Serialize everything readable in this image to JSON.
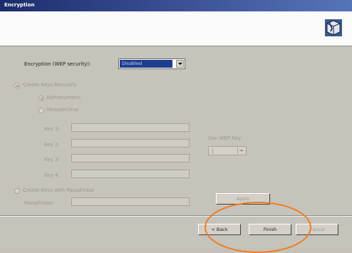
{
  "window": {
    "title": "Encryption"
  },
  "encryption": {
    "label": "Encryption (WEP security):",
    "selected": "Disabled"
  },
  "manual": {
    "radio_label": "Create Keys Manually",
    "alphanumeric_label": "Alphanumeric",
    "hexadecimal_label": "Hexadecimal",
    "keys": [
      {
        "label": "Key 1:",
        "value": ""
      },
      {
        "label": "Key 2:",
        "value": ""
      },
      {
        "label": "Key 3:",
        "value": ""
      },
      {
        "label": "Key 4:",
        "value": ""
      }
    ],
    "use_key_label": "Use WEP Key:",
    "use_key_value": "1"
  },
  "passphrase": {
    "radio_label": "Create Keys with Passphrase",
    "label": "Passphrase:",
    "value": "",
    "apply_label": "Apply"
  },
  "buttons": {
    "back": "< Back",
    "finish": "Finish",
    "cancel": "Cancel"
  },
  "colors": {
    "title_bar": "#1c2d6e",
    "selection": "#1d3d8f",
    "highlight_circle": "#f07d20"
  },
  "icons": {
    "wizard": "wizard-icon"
  }
}
